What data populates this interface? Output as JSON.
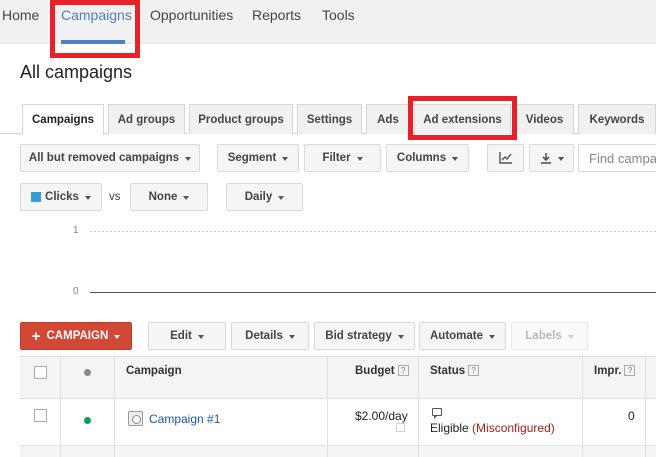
{
  "top_nav": {
    "items": [
      {
        "label": "Home",
        "active": false
      },
      {
        "label": "Campaigns",
        "active": true
      },
      {
        "label": "Opportunities",
        "active": false
      },
      {
        "label": "Reports",
        "active": false
      },
      {
        "label": "Tools",
        "active": false
      }
    ]
  },
  "page_title": "All campaigns",
  "tabs": [
    {
      "label": "Campaigns",
      "active": true
    },
    {
      "label": "Ad groups"
    },
    {
      "label": "Product groups"
    },
    {
      "label": "Settings"
    },
    {
      "label": "Ads"
    },
    {
      "label": "Ad extensions"
    },
    {
      "label": "Videos"
    },
    {
      "label": "Keywords"
    }
  ],
  "toolbar": {
    "filter_scope": "All but removed campaigns",
    "segment": "Segment",
    "filter": "Filter",
    "columns": "Columns",
    "chart_icon": "line-chart-icon",
    "download_icon": "download-icon",
    "search_placeholder": "Find campaigns"
  },
  "chart_controls": {
    "metric1": "Clicks",
    "metric1_color": "#3b9ad9",
    "vs": "vs",
    "metric2": "None",
    "interval": "Daily"
  },
  "chart": {
    "y_ticks": [
      "1",
      "0"
    ]
  },
  "actions": {
    "add_campaign": "CAMPAIGN",
    "edit": "Edit",
    "details": "Details",
    "bid_strategy": "Bid strategy",
    "automate": "Automate",
    "labels": "Labels"
  },
  "table": {
    "headers": {
      "campaign": "Campaign",
      "budget": "Budget",
      "status": "Status",
      "impr": "Impr."
    },
    "help_glyph": "?",
    "rows": [
      {
        "status_dot_color": "#0f9d58",
        "campaign": "Campaign #1",
        "budget": "$2.00/day",
        "status_main": "Eligible",
        "status_detail": "(Misconfigured)",
        "impr": "0"
      }
    ]
  },
  "colors": {
    "accent": "#4c80c9",
    "highlight": "#e8202a",
    "primary_button": "#d14836"
  }
}
